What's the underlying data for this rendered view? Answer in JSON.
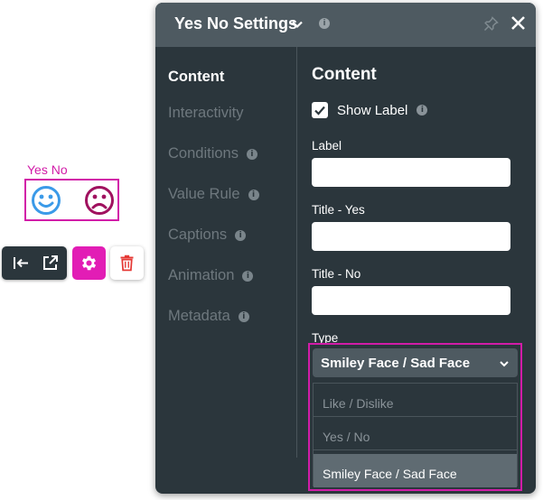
{
  "widget": {
    "label": "Yes No",
    "happy_icon": "smiley-face-icon",
    "sad_icon": "sad-face-icon",
    "happy_color": "#3b9ae8",
    "sad_color": "#a0115f",
    "highlight_color": "#d21ca8"
  },
  "toolbar": {
    "collapse_icon": "collapse-left-icon",
    "open_icon": "external-link-icon",
    "settings_icon": "gear-icon",
    "delete_icon": "trash-icon",
    "settings_color": "#e21db5",
    "delete_color": "#e53935"
  },
  "panel": {
    "title": "Yes No Settings",
    "info_glyph": "i",
    "pin_icon": "pin-icon",
    "close_icon": "close-icon"
  },
  "nav": {
    "items": [
      {
        "label": "Content",
        "info": ""
      },
      {
        "label": "Interactivity",
        "info": ""
      },
      {
        "label": "Conditions",
        "info": "i"
      },
      {
        "label": "Value Rule",
        "info": "i"
      },
      {
        "label": "Captions",
        "info": "i"
      },
      {
        "label": "Animation",
        "info": "i"
      },
      {
        "label": "Metadata",
        "info": "i"
      }
    ]
  },
  "content": {
    "title": "Content",
    "show_label": {
      "text": "Show Label",
      "checked": true,
      "info": "i"
    },
    "label_field": {
      "label": "Label",
      "value": ""
    },
    "title_yes_field": {
      "label": "Title - Yes",
      "value": ""
    },
    "title_no_field": {
      "label": "Title - No",
      "value": ""
    },
    "type": {
      "label": "Type",
      "selected": "Smiley Face / Sad Face",
      "options": [
        "Like / Dislike",
        "Yes / No",
        "Smiley Face / Sad Face"
      ]
    }
  }
}
